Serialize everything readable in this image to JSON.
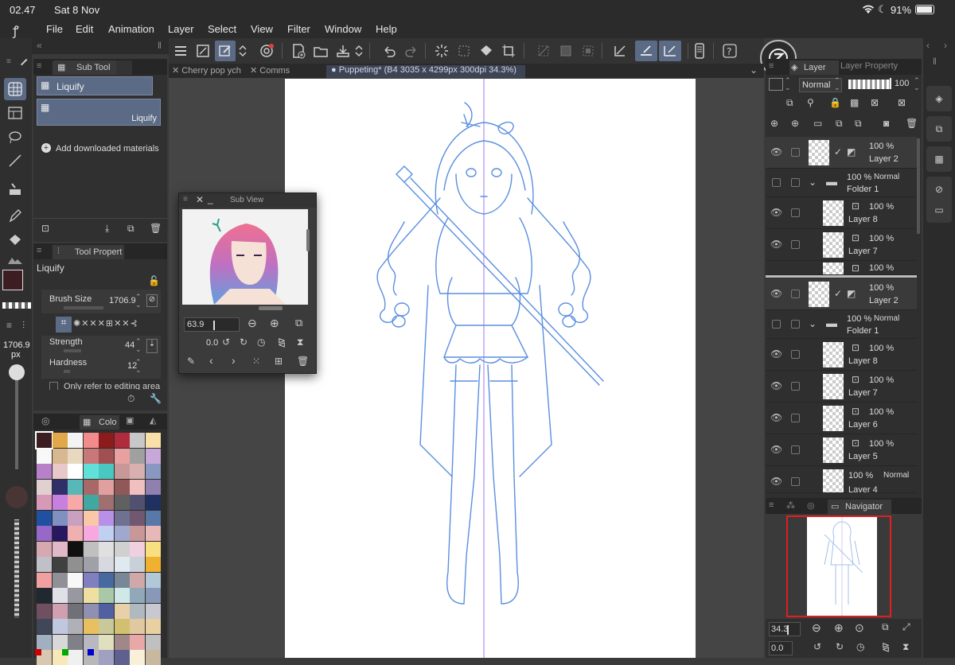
{
  "status": {
    "time": "02.47",
    "date": "Sat 8 Nov",
    "battery": "91%"
  },
  "menu": [
    "File",
    "Edit",
    "Animation",
    "Layer",
    "Select",
    "View",
    "Filter",
    "Window",
    "Help"
  ],
  "subtool": {
    "tab_label": "Sub Tool",
    "items": [
      {
        "label": "Liquify"
      },
      {
        "label": "Liquify"
      }
    ],
    "add_materials": "Add downloaded materials"
  },
  "toolprop": {
    "tab_label": "Tool Propert",
    "name": "Liquify",
    "brush_size_label": "Brush Size",
    "brush_size_value": "1706.9",
    "strength_label": "Strength",
    "strength_value": "44",
    "hardness_label": "Hardness",
    "hardness_value": "12",
    "refer_label": "Only refer to editing area"
  },
  "left": {
    "size_value": "1706.9",
    "size_unit": "px"
  },
  "colorset": {
    "tab_label": "Colo"
  },
  "tabs": [
    {
      "label": "Cherry pop ych"
    },
    {
      "label": "Comms"
    },
    {
      "label": "Puppeting* (B4 3035 x 4299px 300dpi 34.3%)"
    }
  ],
  "subview": {
    "title": "Sub View",
    "zoom": "63.9",
    "rotation": "0.0"
  },
  "layer_panel": {
    "tab_layer": "Layer",
    "tab_property": "Layer Property",
    "blend_mode": "Normal",
    "opacity": "100",
    "layers": [
      {
        "opacity": "100 %",
        "mode": "",
        "name": "Layer 2"
      },
      {
        "opacity": "100 %",
        "mode": "Normal",
        "name": "Folder 1"
      },
      {
        "opacity": "100 %",
        "mode": "",
        "name": "Layer 8"
      },
      {
        "opacity": "100 %",
        "mode": "",
        "name": "Layer 7"
      },
      {
        "opacity": "100 %",
        "mode": "",
        "name": ""
      },
      {
        "opacity": "100 %",
        "mode": "",
        "name": "Layer 2"
      },
      {
        "opacity": "100 %",
        "mode": "Normal",
        "name": "Folder 1"
      },
      {
        "opacity": "100 %",
        "mode": "",
        "name": "Layer 8"
      },
      {
        "opacity": "100 %",
        "mode": "",
        "name": "Layer 7"
      },
      {
        "opacity": "100 %",
        "mode": "",
        "name": "Layer 6"
      },
      {
        "opacity": "100 %",
        "mode": "",
        "name": "Layer 5"
      },
      {
        "opacity": "100 %",
        "mode": "Normal",
        "name": "Layer 4"
      }
    ]
  },
  "navigator": {
    "tab_label": "Navigator",
    "zoom": "34.3",
    "rotation": "0.0"
  },
  "colors": {
    "accent": "#5b6a85",
    "guide": "#b48cf0",
    "sketch": "#5a8fe0",
    "main_color": "#3b1d22",
    "swatches": [
      "#3b1d22",
      "#e0a848",
      "#f4f4f4",
      "#f28c8c",
      "#8c1c1c",
      "#b02c3c",
      "#c8c8c8",
      "#f8e0a8",
      "#f8f8f8",
      "#d8b890",
      "#e8d8c0",
      "#c87878",
      "#a05050",
      "#e8a0a0",
      "#a0a0a0",
      "#c8a8d8",
      "#b880c8",
      "#e8c8c8",
      "#ffffff",
      "#60e0d8",
      "#48c8c0",
      "#c89898",
      "#d8b0b0",
      "#8898c0",
      "#e0d0d0",
      "#303068",
      "#58b8b8",
      "#a86868",
      "#e0a0a0",
      "#905858",
      "#f0c0c0",
      "#9080b0",
      "#d898b8",
      "#c880e0",
      "#f8a8a8",
      "#40a8a0",
      "#a07070",
      "#606060",
      "#505070",
      "#203060",
      "#2050a0",
      "#8090c0",
      "#c8a0c0",
      "#f8c8a8",
      "#b890e8",
      "#707090",
      "#705870",
      "#5878a8",
      "#9868c8",
      "#281860",
      "#f0b0b0",
      "#f8a8e0",
      "#c0d0f0",
      "#a0a8d0",
      "#c89898",
      "#e8b8b8",
      "#d8a8b0",
      "#e0b8c8",
      "#101010",
      "#c0c0c0",
      "#e0e0e0",
      "#d0d0d0",
      "#f0d0e0",
      "#f8e080",
      "#c0c0c8",
      "#404040",
      "#909090",
      "#a0a0a8",
      "#d8d8e0",
      "#e0e8f0",
      "#c8d0d8",
      "#f0b030",
      "#f0a0a0",
      "#909098",
      "#f8f8f8",
      "#8080c0",
      "#4868a0",
      "#788898",
      "#d0a8a8",
      "#b0c8d8",
      "#202830",
      "#e0e0e8",
      "#9898a0",
      "#f0e0a0",
      "#a8c8a8",
      "#d0e8e8",
      "#90a8b8",
      "#8898b8",
      "#705060",
      "#d0a0b0",
      "#707078",
      "#9090b0",
      "#5060a0",
      "#e8d0a8",
      "#b0b8c0",
      "#c8c8d0",
      "#404858",
      "#c0c8e0",
      "#b0b0b8",
      "#e8c060",
      "#c8c898",
      "#d0c070",
      "#e0c8a0",
      "#e8d0a0",
      "#a0b0c0",
      "#d8d8d8",
      "#808088",
      "#b8b8c0",
      "#e0e0c0",
      "#a08888",
      "#e8a8a8",
      "#c0c0c0",
      "#d8c8b0",
      "#f8e8b8",
      "#f0f0f0",
      "#b8b8b8",
      "#a0a0c0",
      "#606090",
      "#f8f0d8",
      "#c8b8a0"
    ]
  }
}
